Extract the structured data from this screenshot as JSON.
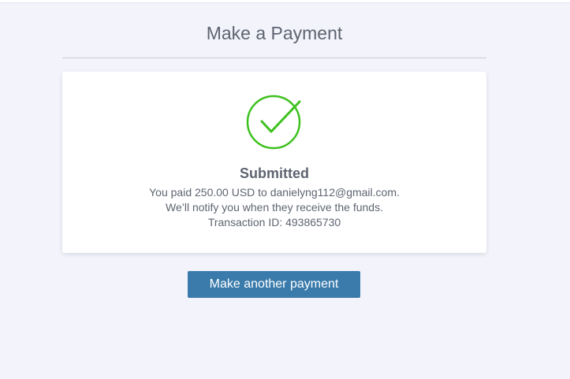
{
  "header": {
    "title": "Make a Payment"
  },
  "confirmation": {
    "icon": "check-circle-icon",
    "status": "Submitted",
    "message_line1": "You paid 250.00 USD to danielyng112@gmail.com.",
    "message_line2": "We’ll notify you when they receive the funds.",
    "transaction_line": "Transaction ID: 493865730"
  },
  "actions": {
    "another_payment_label": "Make another payment"
  },
  "colors": {
    "success": "#3ec11f",
    "primary_button": "#3a7bab",
    "background": "#f2f3fb",
    "text": "#5e6470"
  }
}
